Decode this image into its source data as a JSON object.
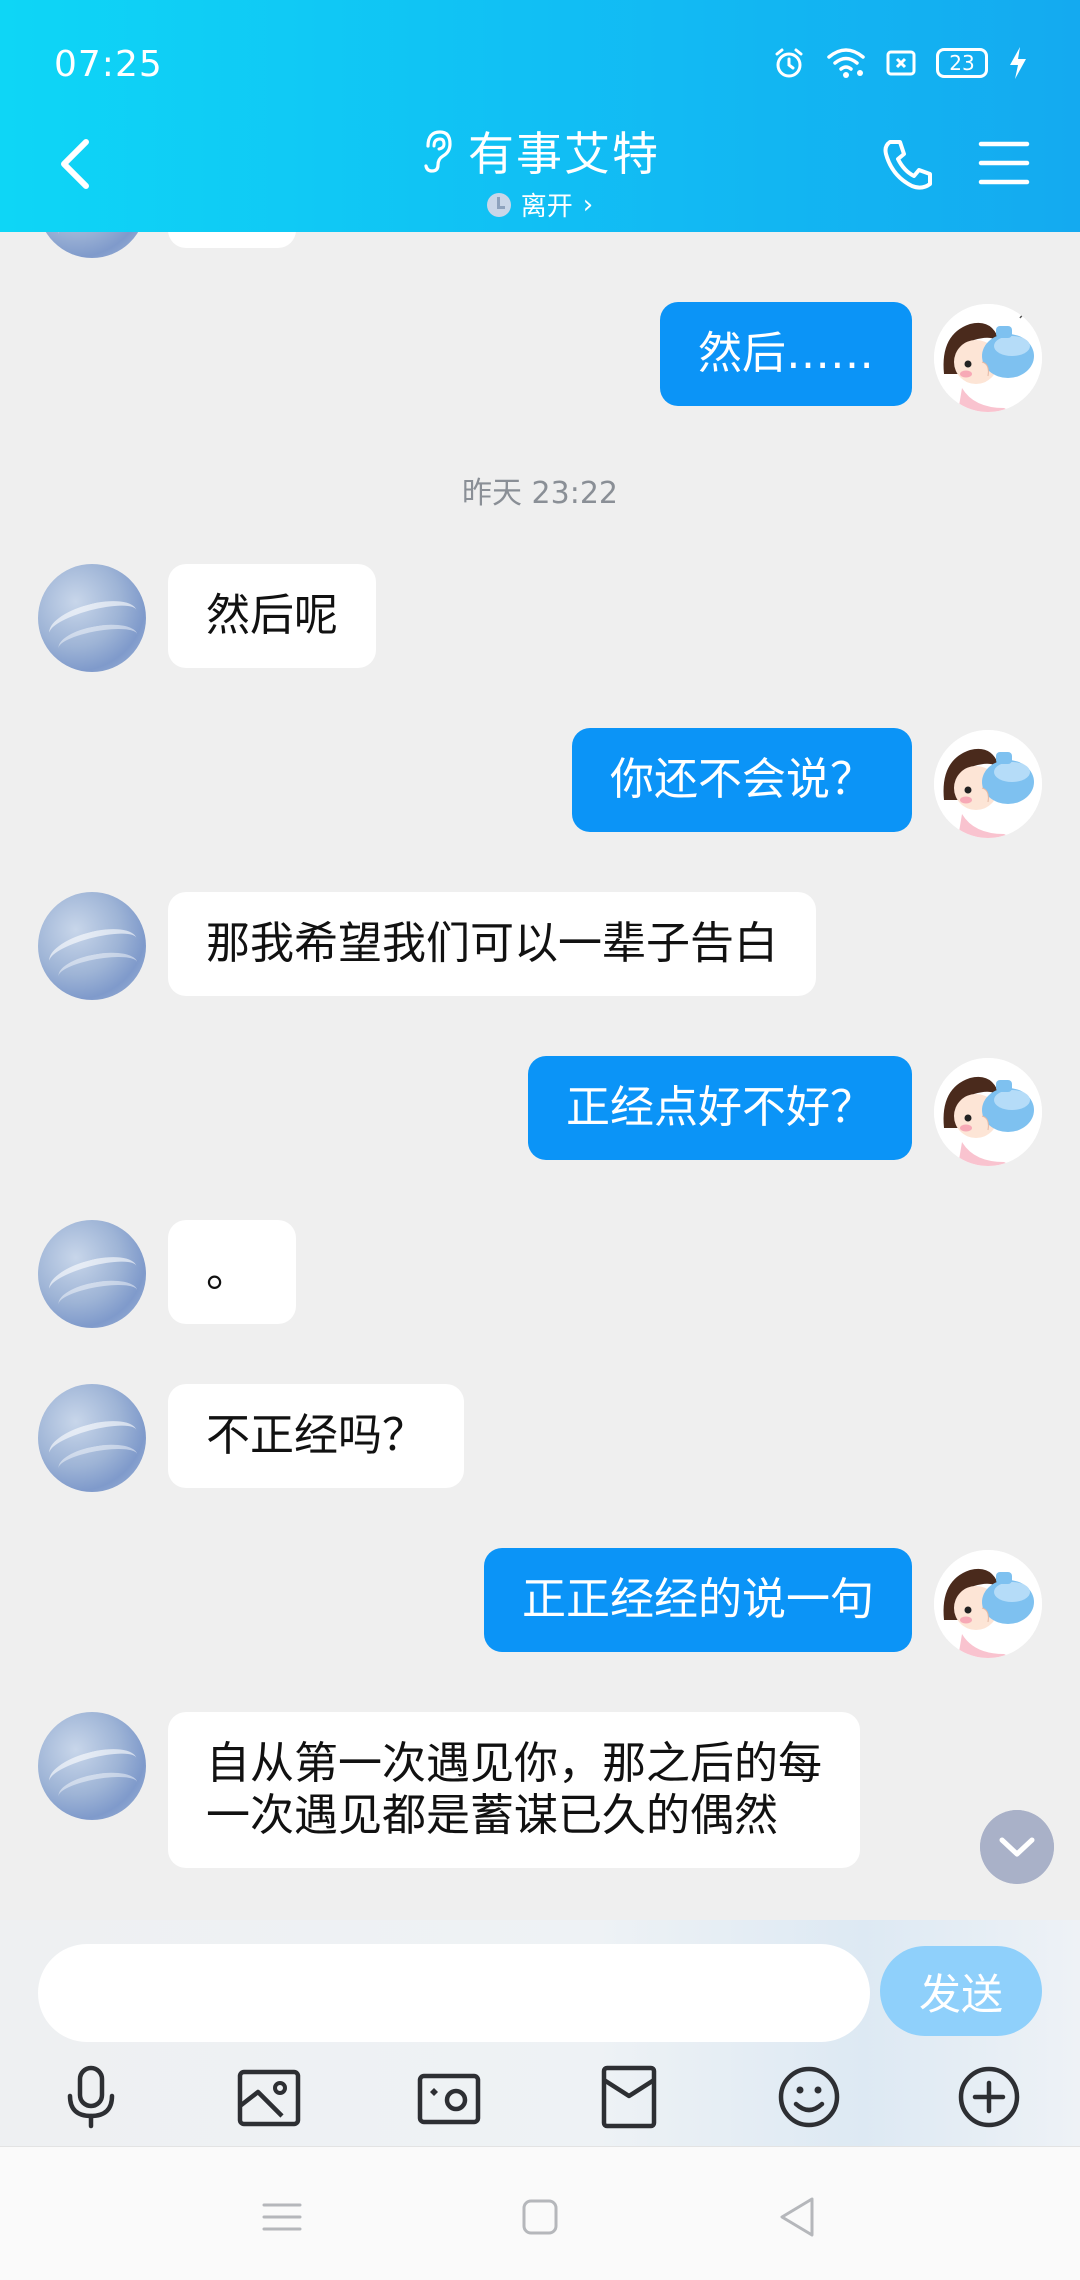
{
  "status_bar": {
    "time": "07:25",
    "battery": "23",
    "icons": [
      "alarm-icon",
      "wifi-icon",
      "sim-off-icon",
      "battery-icon",
      "charging-icon"
    ]
  },
  "header": {
    "title": "有事艾特",
    "subtitle": "离开",
    "subtitle_chevron": "›",
    "colors": {
      "gradient_start": "#0ed6f6",
      "gradient_end": "#14aaf0"
    }
  },
  "chat": {
    "messages": [
      {
        "side": "right",
        "text": "然后……"
      },
      {
        "type": "timestamp",
        "text": "昨天 23:22"
      },
      {
        "side": "left",
        "text": "然后呢"
      },
      {
        "side": "right",
        "text": "你还不会说？"
      },
      {
        "side": "left",
        "text": "那我希望我们可以一辈子告白"
      },
      {
        "side": "right",
        "text": "正经点好不好？"
      },
      {
        "side": "left",
        "text": "。"
      },
      {
        "side": "left",
        "text": "不正经吗？"
      },
      {
        "side": "right",
        "text": "正正经经的说一句"
      },
      {
        "side": "left",
        "line1": "自从第一次遇见你，那之后的每",
        "line2": "一次遇见都是蓄谋已久的偶然"
      }
    ],
    "colors": {
      "outgoing_bubble": "#0b94f7",
      "incoming_bubble": "#ffffff"
    }
  },
  "composer": {
    "input_value": "",
    "send_label": "发送",
    "tools": [
      "microphone-icon",
      "image-icon",
      "camera-icon",
      "red-packet-icon",
      "emoji-icon",
      "plus-icon"
    ]
  },
  "nav": [
    "menu-nav-icon",
    "home-nav-icon",
    "back-nav-icon"
  ]
}
